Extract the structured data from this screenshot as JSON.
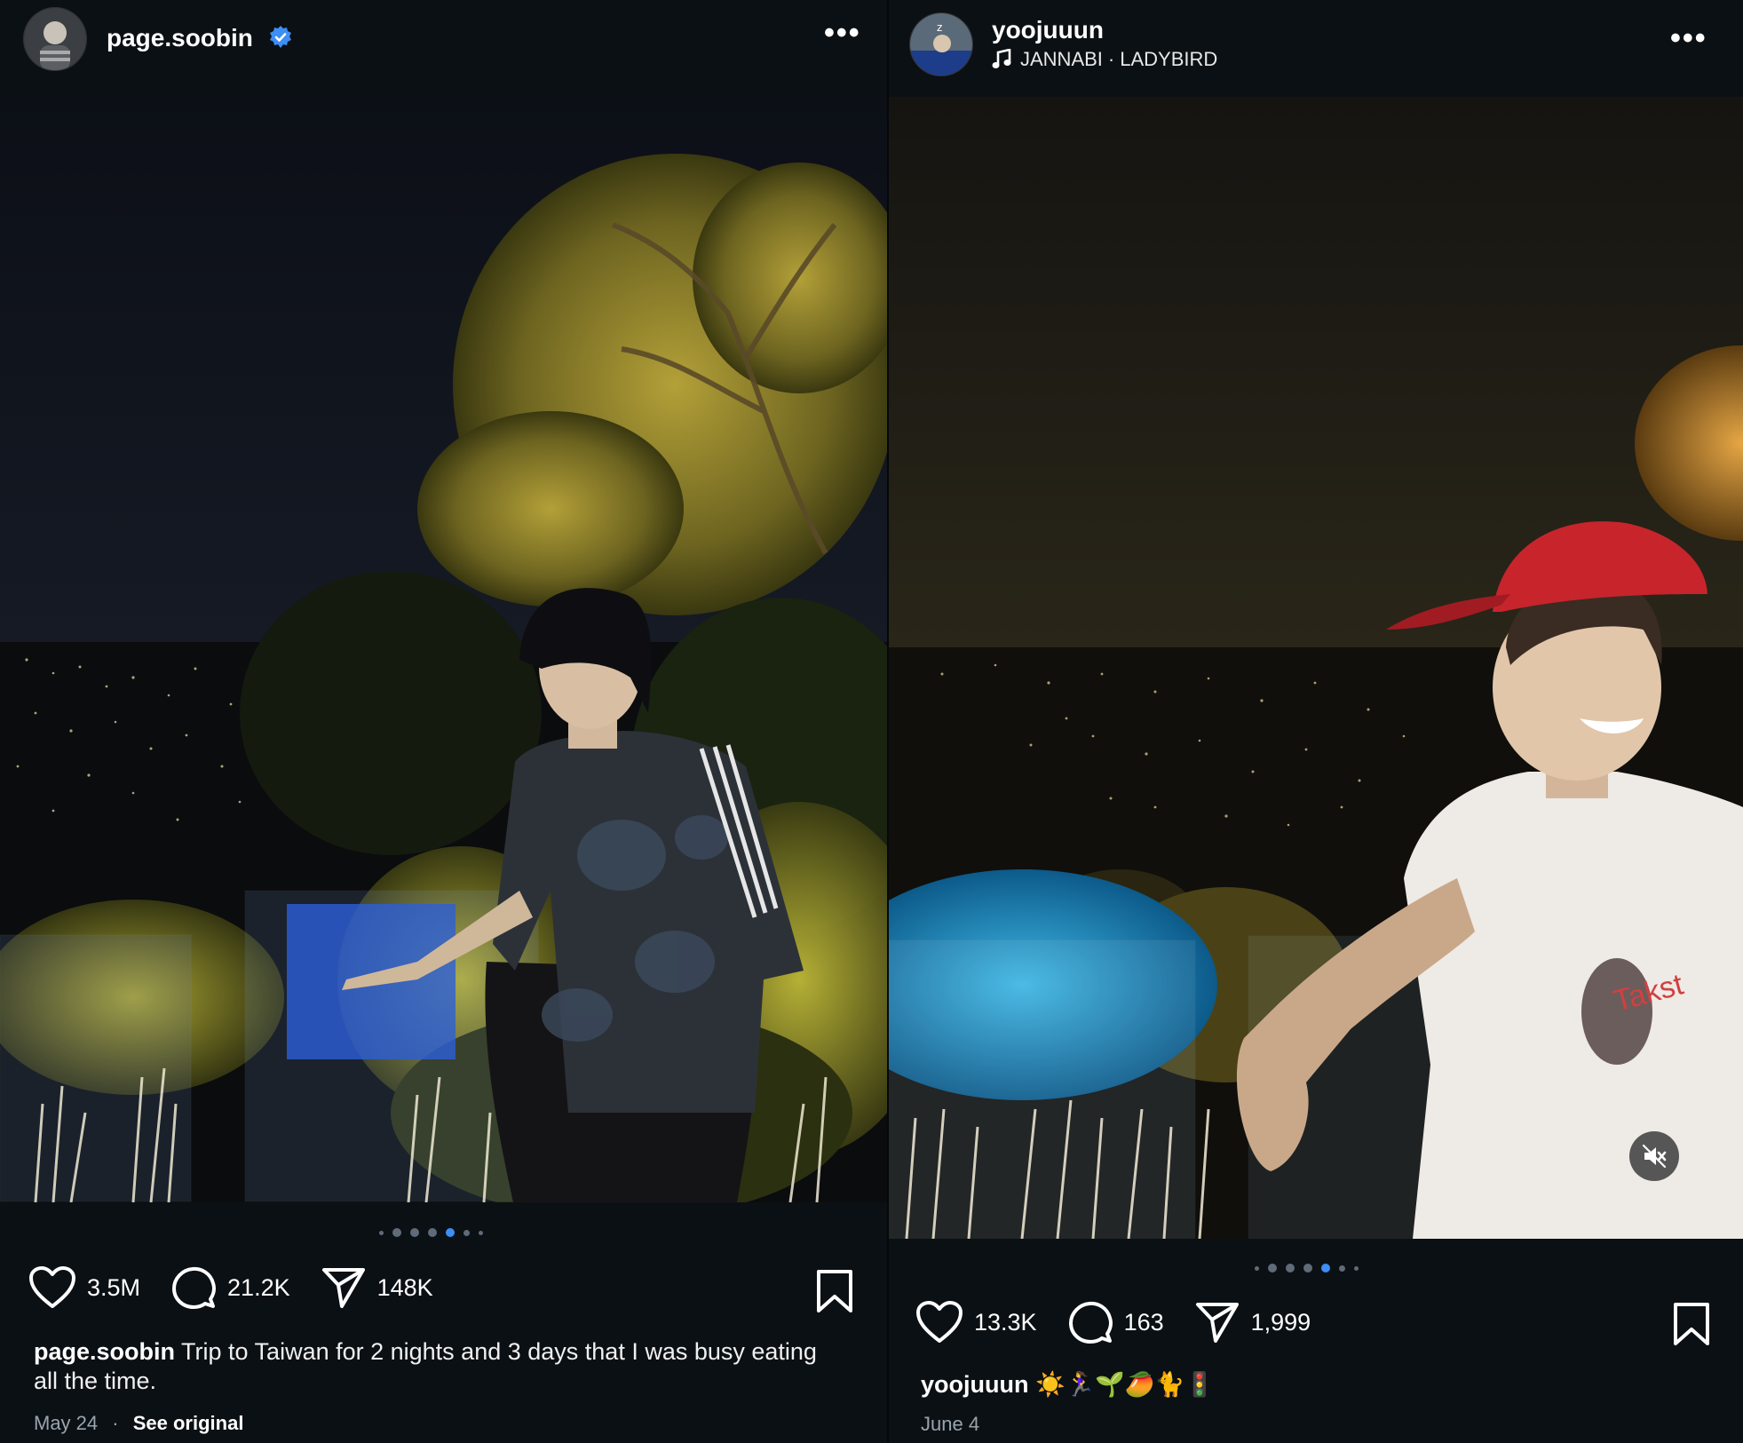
{
  "left_post": {
    "username": "page.soobin",
    "verified": true,
    "likes": "3.5M",
    "comments": "21.2K",
    "shares": "148K",
    "caption_user": "page.soobin",
    "caption_text": " Trip to Taiwan for 2 nights and 3 days that I was busy eating all the time.",
    "date": "May 24",
    "separator": "·",
    "see_original": "See original",
    "carousel_dots": 7,
    "active_dot": 4
  },
  "right_post": {
    "username": "yoojuuun",
    "music_artist": "JANNABI",
    "music_separator": "·",
    "music_title": "LADYBIRD",
    "likes": "13.3K",
    "comments": "163",
    "shares": "1,999",
    "caption_user": "yoojuuun",
    "caption_emojis": "☀️🏃‍♀️🌱🥭🐈🚦",
    "date": "June 4",
    "carousel_dots": 7,
    "active_dot": 4
  },
  "icons": [
    "verified-badge-icon",
    "more-icon",
    "heart-icon",
    "comment-icon",
    "share-icon",
    "bookmark-icon",
    "music-note-icon",
    "mute-icon"
  ],
  "colors": {
    "background": "#0b1014",
    "verified": "#3d8ef5",
    "active_dot": "#3d8ef5",
    "inactive_dot": "#5f6b78"
  }
}
